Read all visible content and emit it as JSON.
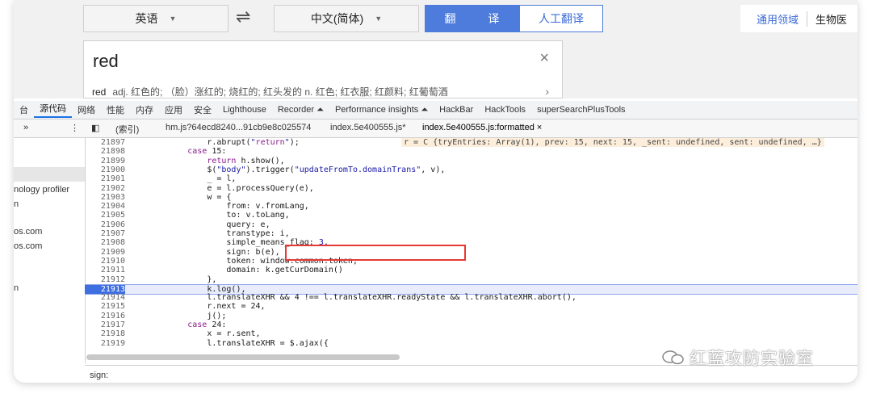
{
  "translator": {
    "source_lang": "英语",
    "swap_glyph": "⇌",
    "target_lang": "中文(简体)",
    "translate_button": "翻 译",
    "human_translate_button": "人工翻译",
    "domain_general": "通用领域",
    "domain_bio": "生物医",
    "input_text": "red",
    "close_glyph": "×",
    "suggestion_word": "red",
    "suggestion_text": "adj. 红色的; （脸）涨红的; 烧红的; 红头发的 n. 红色; 红衣服; 红颜料; 红葡萄酒",
    "suggestion_arrow": "›"
  },
  "devtools": {
    "tabs": [
      "台",
      "源代码",
      "网络",
      "性能",
      "内存",
      "应用",
      "安全",
      "Lighthouse",
      "Recorder ⏶",
      "Performance insights ⏶",
      "HackBar",
      "HackTools",
      "superSearchPlusTools"
    ],
    "active_tab": "源代码",
    "nav_more": "»",
    "nav_menu": "⋮",
    "panel_toggle": "◧",
    "index_label": "(索引)",
    "file_tabs": [
      "hm.js?64ecd8240...91cb9e8c025574",
      "index.5e400555.js*",
      "index.5e400555.js:formatted"
    ],
    "file_tab_close": "×",
    "sidebar_items": [
      "nology profiler",
      "n",
      "os.com",
      "os.com",
      "n"
    ],
    "code_lines": [
      {
        "n": "21897",
        "code": "                r.abrupt(\"return\");",
        "inline": "r = C {tryEntries: Array(1), prev: 15, next: 15, _sent: undefined, sent: undefined, …}"
      },
      {
        "n": "21898",
        "code": "            case 15:"
      },
      {
        "n": "21899",
        "code": "                return h.show(),"
      },
      {
        "n": "21900",
        "code": "                $(\"body\").trigger(\"updateFromTo.domainTrans\", v),"
      },
      {
        "n": "21901",
        "code": "                _ = l,"
      },
      {
        "n": "21902",
        "code": "                e = l.processQuery(e),"
      },
      {
        "n": "21903",
        "code": "                w = {"
      },
      {
        "n": "21904",
        "code": "                    from: v.fromLang,"
      },
      {
        "n": "21905",
        "code": "                    to: v.toLang,"
      },
      {
        "n": "21906",
        "code": "                    query: e,"
      },
      {
        "n": "21907",
        "code": "                    transtype: i,"
      },
      {
        "n": "21908",
        "code": "                    simple_means_flag: 3,"
      },
      {
        "n": "21909",
        "code": "                    sign: b(e),"
      },
      {
        "n": "21910",
        "code": "                    token: window.common.token,"
      },
      {
        "n": "21911",
        "code": "                    domain: k.getCurDomain()"
      },
      {
        "n": "21912",
        "code": "                },"
      },
      {
        "n": "21913",
        "code": "                k.log(),",
        "highlight": true
      },
      {
        "n": "21914",
        "code": "                l.translateXHR && 4 !== l.translateXHR.readyState && l.translateXHR.abort(),"
      },
      {
        "n": "21915",
        "code": "                r.next = 24,"
      },
      {
        "n": "21916",
        "code": "                j();"
      },
      {
        "n": "21917",
        "code": "            case 24:"
      },
      {
        "n": "21918",
        "code": "                x = r.sent,"
      },
      {
        "n": "21919",
        "code": "                l.translateXHR = $.ajax({"
      }
    ],
    "search_query": "sign:"
  },
  "watermark": "红蓝攻防实验室"
}
